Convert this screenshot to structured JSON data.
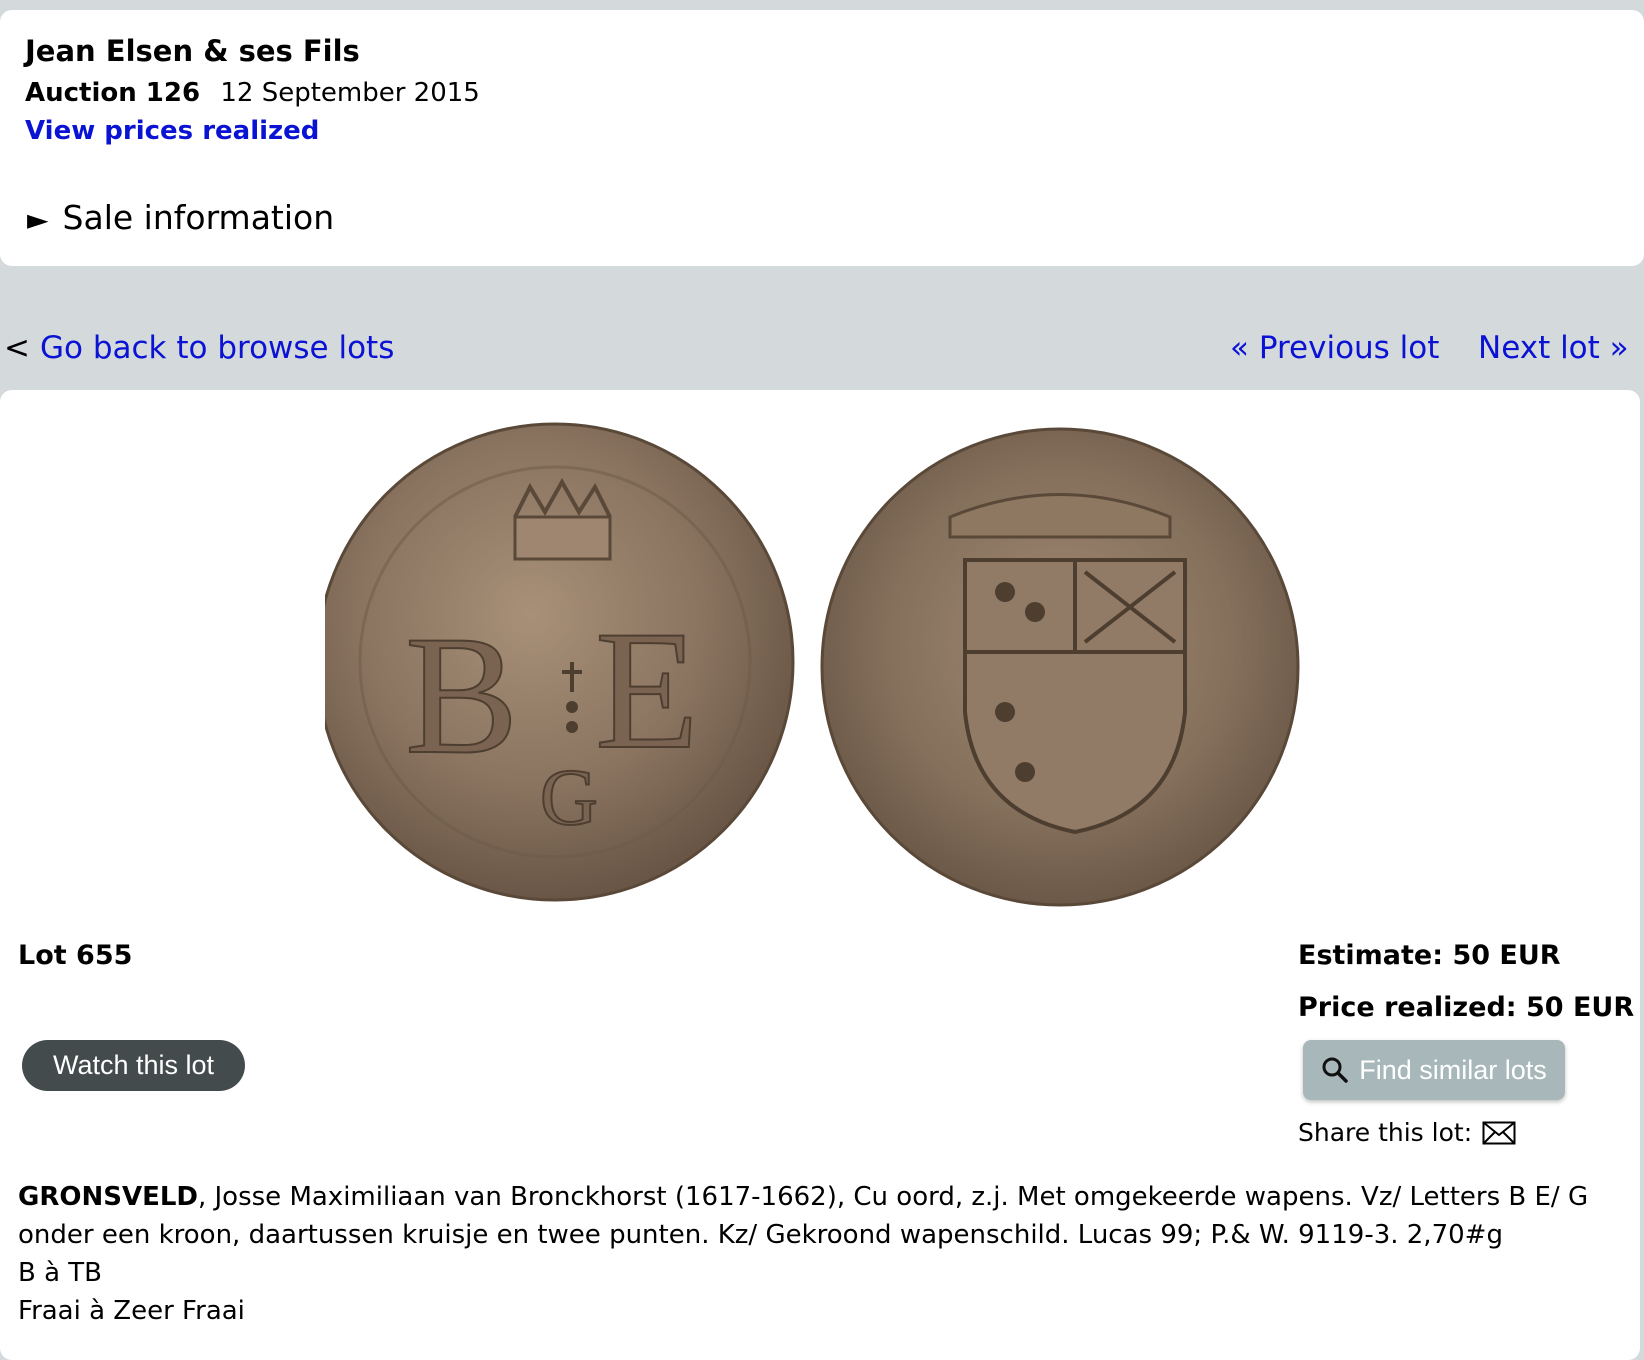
{
  "header": {
    "auction_house": "Jean Elsen & ses Fils",
    "auction_label": "Auction 126",
    "auction_date": "12 September 2015",
    "prices_link": "View prices realized",
    "sale_info": "Sale information",
    "sale_info_icon": "triangle-right-icon"
  },
  "nav": {
    "back_prefix": "<",
    "back_link": "Go back to browse lots",
    "previous": "« Previous lot",
    "next": "Next lot »"
  },
  "lot": {
    "number": "Lot 655",
    "estimate": "Estimate: 50 EUR",
    "price_realized": "Price realized: 50 EUR",
    "watch_button": "Watch this lot",
    "similar_button": "Find similar lots",
    "share_label": "Share this lot:",
    "description": {
      "title": "GRONSVELD",
      "text": ", Josse Maximiliaan van Bronckhorst (1617-1662), Cu oord, z.j. Met omgekeerde wapens. Vz/ Letters B E/ G onder een kroon, daartussen kruisje en twee punten. Kz/ Gekroond wapenschild. Lucas 99; P.& W. 9119-3. 2,70#g",
      "grade_fr": "B à TB",
      "grade_nl": "Fraai à Zeer Fraai"
    }
  },
  "colors": {
    "link": "#0a12d4",
    "page_bg": "#d4d9dc",
    "watch_button": "#434b4c",
    "similar_button": "#a8b8ba",
    "coin": "#8a7460"
  }
}
